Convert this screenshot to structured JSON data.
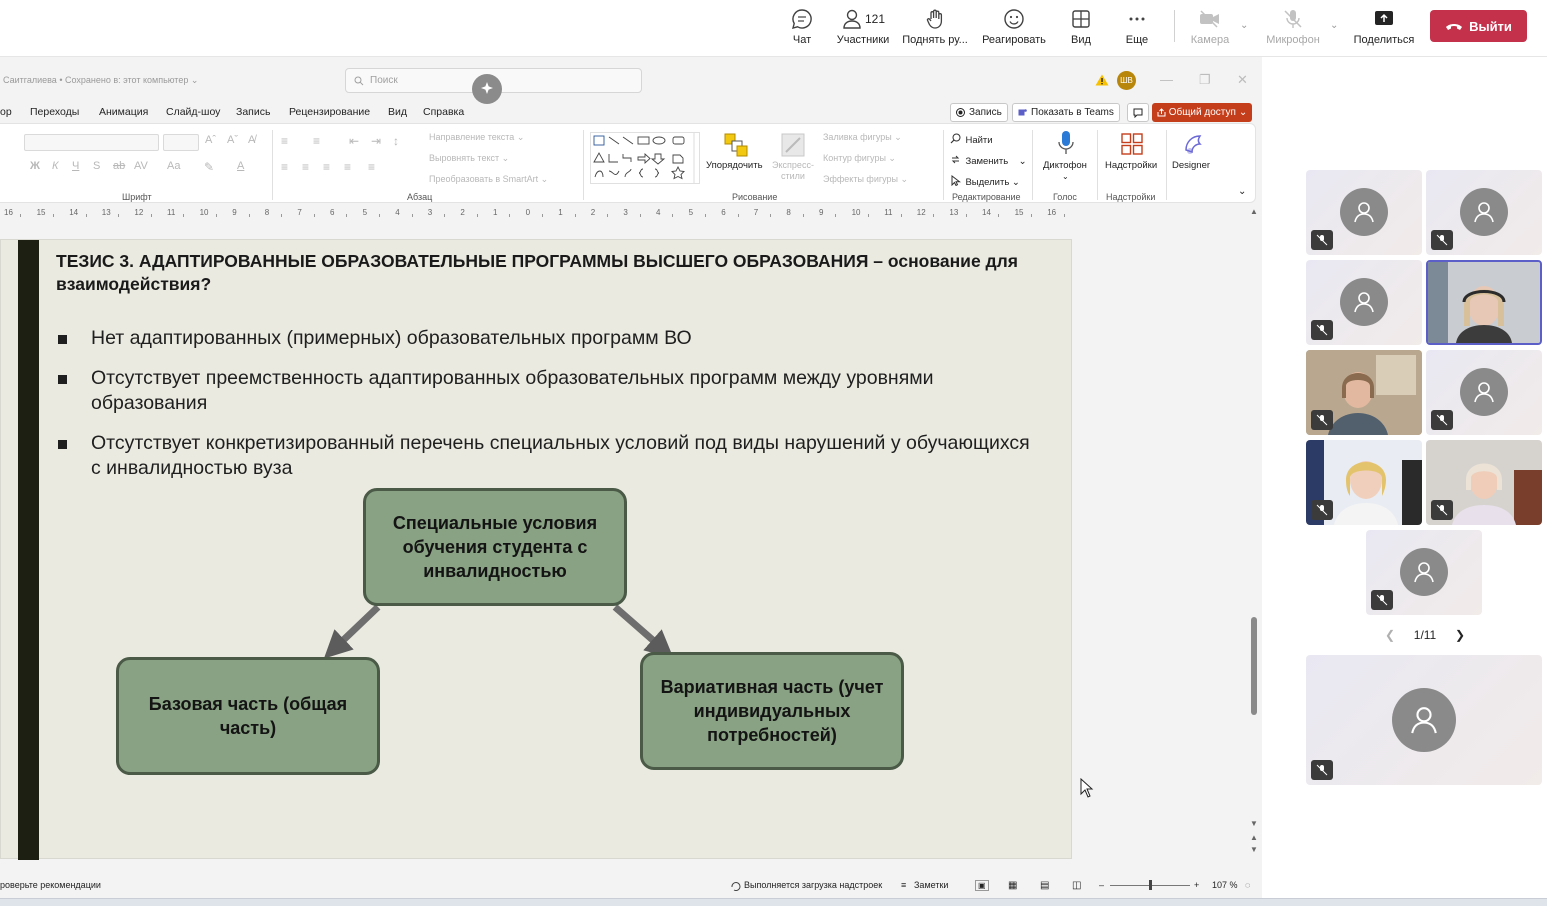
{
  "teams": {
    "chat": "Чат",
    "participants": "Участники",
    "participants_count": "121",
    "raise_hand": "Поднять ру...",
    "react": "Реагировать",
    "view": "Вид",
    "more": "Еще",
    "camera": "Камера",
    "mic": "Микрофон",
    "share": "Поделиться",
    "leave": "Выйти",
    "leave_color": "#c4314b"
  },
  "ppt": {
    "doc_status": "Саитгалиева • Сохранено в: этот компьютер ⌄",
    "search_placeholder": "Поиск",
    "user_initials": "ШВ",
    "tabs": [
      "ор",
      "Переходы",
      "Анимация",
      "Слайд-шоу",
      "Запись",
      "Рецензирование",
      "Вид",
      "Справка"
    ],
    "record": "Запись",
    "present_teams": "Показать в Teams",
    "share": "Общий доступ",
    "share_color": "#c43e1c",
    "ribbon": {
      "font_group": "Шрифт",
      "para_group": "Абзац",
      "draw_group": "Рисование",
      "edit_group": "Редактирование",
      "voice_group": "Голос",
      "addins_group": "Надстройки",
      "text_direction": "Направление текста ⌄",
      "align_text": "Выровнять текст ⌄",
      "smartart": "Преобразовать в SmartArt ⌄",
      "arrange": "Упорядочить",
      "quick_styles": "Экспресс-стили",
      "fill": "Заливка фигуры ⌄",
      "outline": "Контур фигуры ⌄",
      "effects": "Эффекты фигуры ⌄",
      "find": "Найти",
      "replace": "Заменить",
      "select": "Выделить ⌄",
      "dictate": "Диктофон",
      "addins": "Надстройки",
      "designer": "Designer"
    },
    "ruler": [
      "16",
      "15",
      "14",
      "13",
      "12",
      "11",
      "10",
      "9",
      "8",
      "7",
      "6",
      "5",
      "4",
      "3",
      "2",
      "1",
      "0",
      "1",
      "2",
      "3",
      "4",
      "5",
      "6",
      "7",
      "8",
      "9",
      "10",
      "11",
      "12",
      "13",
      "14",
      "15",
      "16"
    ],
    "slide": {
      "title": "ТЕЗИС 3.  АДАПТИРОВАННЫЕ ОБРАЗОВАТЕЛЬНЫЕ ПРОГРАММЫ ВЫСШЕГО ОБРАЗОВАНИЯ – основание для взаимодействия?",
      "bullets": [
        "Нет адаптированных (примерных) образовательных программ ВО",
        "Отсутствует преемственность адаптированных образовательных программ между уровнями образования",
        "Отсутствует конкретизированный перечень специальных условий под виды нарушений у обучающихся с инвалидностью вуза"
      ],
      "box_top": "Специальные условия обучения студента с инвалидностью",
      "box_left": "Базовая часть (общая часть)",
      "box_right": "Вариативная часть (учет индивидуальных потребностей)",
      "box_color": "#88a283"
    },
    "status": {
      "recommend": "роверьте рекомендации",
      "loading": "Выполняется загрузка надстроек",
      "notes": "Заметки",
      "zoom": "107 %"
    }
  },
  "participants_pager": "1/11"
}
